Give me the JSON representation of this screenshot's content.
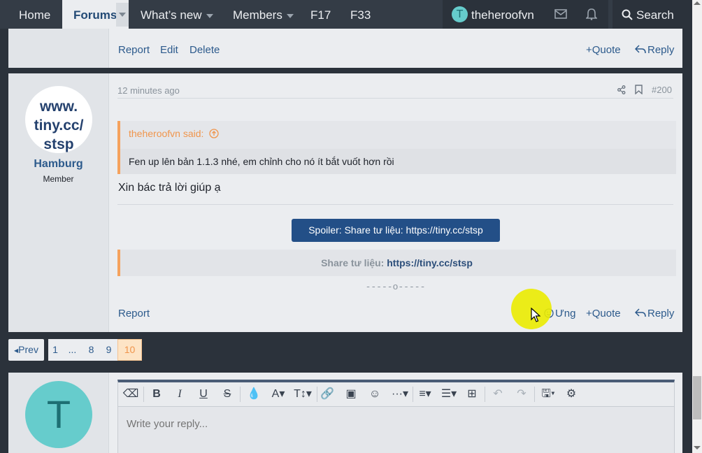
{
  "nav": {
    "home": "Home",
    "forums": "Forums",
    "whats_new": "What’s new",
    "members": "Members",
    "f17": "F17",
    "f33": "F33",
    "user_initial": "T",
    "username": "theheroofvn",
    "search": "Search"
  },
  "prev_post": {
    "actions": {
      "report": "Report",
      "edit": "Edit",
      "delete": "Delete",
      "quote": "Quote",
      "reply": "Reply"
    }
  },
  "post": {
    "avatar_text": [
      "www.",
      "tiny.cc/",
      "stsp"
    ],
    "author": "Hamburg",
    "role": "Member",
    "time": "12 minutes ago",
    "number": "#200",
    "quote_author": "theheroofvn said:",
    "quote_text": "Fen up lên bản 1.1.3 nhé, em chỉnh cho nó ít bắt vuốt hơn rồi",
    "body": "Xin bác trả lời giúp ạ",
    "spoiler_label": "Spoiler: Share tư liệu: https://tiny.cc/stsp",
    "share_label": "Share tư liệu:",
    "share_link": "https://tiny.cc/stsp",
    "divider": "-----o-----",
    "actions": {
      "report": "Report",
      "react": "Ưng",
      "quote": "Quote",
      "reply": "Reply"
    }
  },
  "pagination": {
    "prev": "Prev",
    "pages": [
      "1",
      "...",
      "8",
      "9",
      "10"
    ],
    "current": "10"
  },
  "reply": {
    "avatar_initial": "T",
    "placeholder": "Write your reply..."
  },
  "colors": {
    "accent": "#234f87",
    "quote_border": "#f5a25d",
    "avatar": "#66cccc"
  }
}
